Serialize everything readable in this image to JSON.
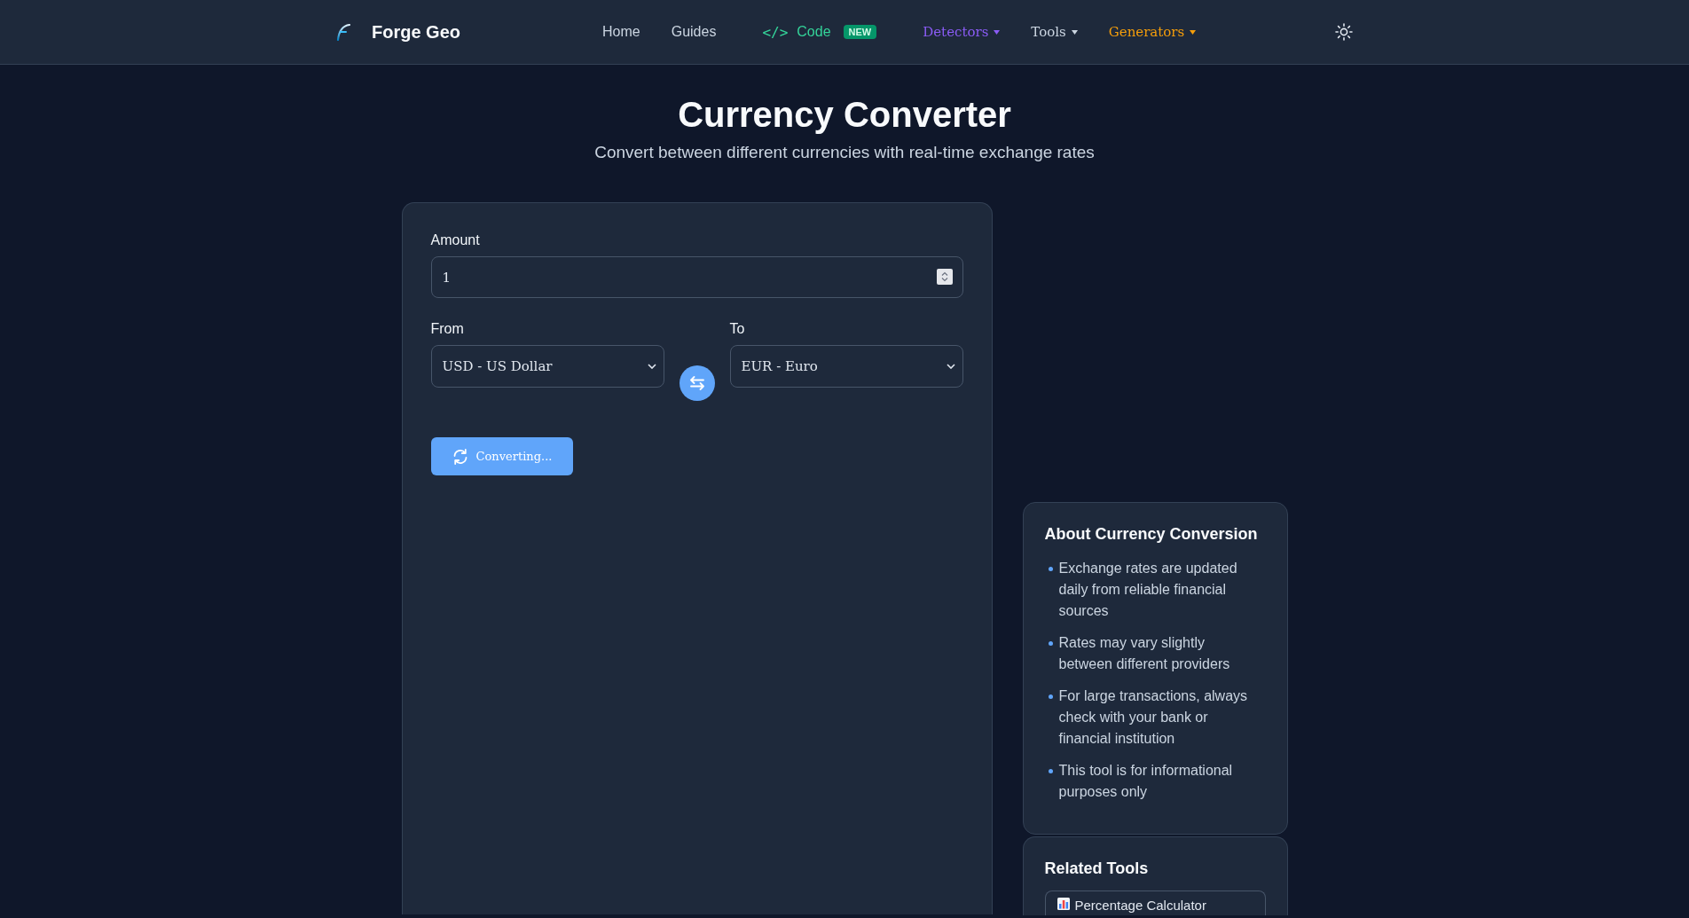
{
  "nav": {
    "brand": "Forge Geo",
    "links": [
      {
        "label": "Home",
        "kind": "link",
        "color": "#cbd5e1"
      },
      {
        "label": "Guides",
        "kind": "link",
        "color": "#cbd5e1"
      },
      {
        "label": "Code",
        "kind": "code",
        "prefix": "</>",
        "badge": "NEW",
        "color": "#34d399"
      },
      {
        "label": "Detectors",
        "kind": "dropdown",
        "color": "#8b5cf6"
      },
      {
        "label": "Tools",
        "kind": "dropdown",
        "color": "#cbd5e1"
      },
      {
        "label": "Generators",
        "kind": "dropdown",
        "color": "#f59e0b"
      }
    ]
  },
  "header": {
    "title": "Currency Converter",
    "subtitle": "Convert between different currencies with real-time exchange rates"
  },
  "converter": {
    "amount": {
      "label": "Amount",
      "value": "1"
    },
    "from": {
      "label": "From",
      "value": "USD - US Dollar"
    },
    "to": {
      "label": "To",
      "value": "EUR - Euro"
    },
    "convert_button": {
      "label": "Converting...",
      "loading": true
    }
  },
  "sidebar": {
    "about": {
      "title": "About Currency Conversion",
      "items": [
        "Exchange rates are updated daily from reliable financial sources",
        "Rates may vary slightly between different providers",
        "For large transactions, always check with your bank or financial institution",
        "This tool is for informational purposes only"
      ]
    },
    "related": {
      "title": "Related Tools",
      "items": [
        {
          "label": "Percentage Calculator"
        }
      ]
    }
  }
}
